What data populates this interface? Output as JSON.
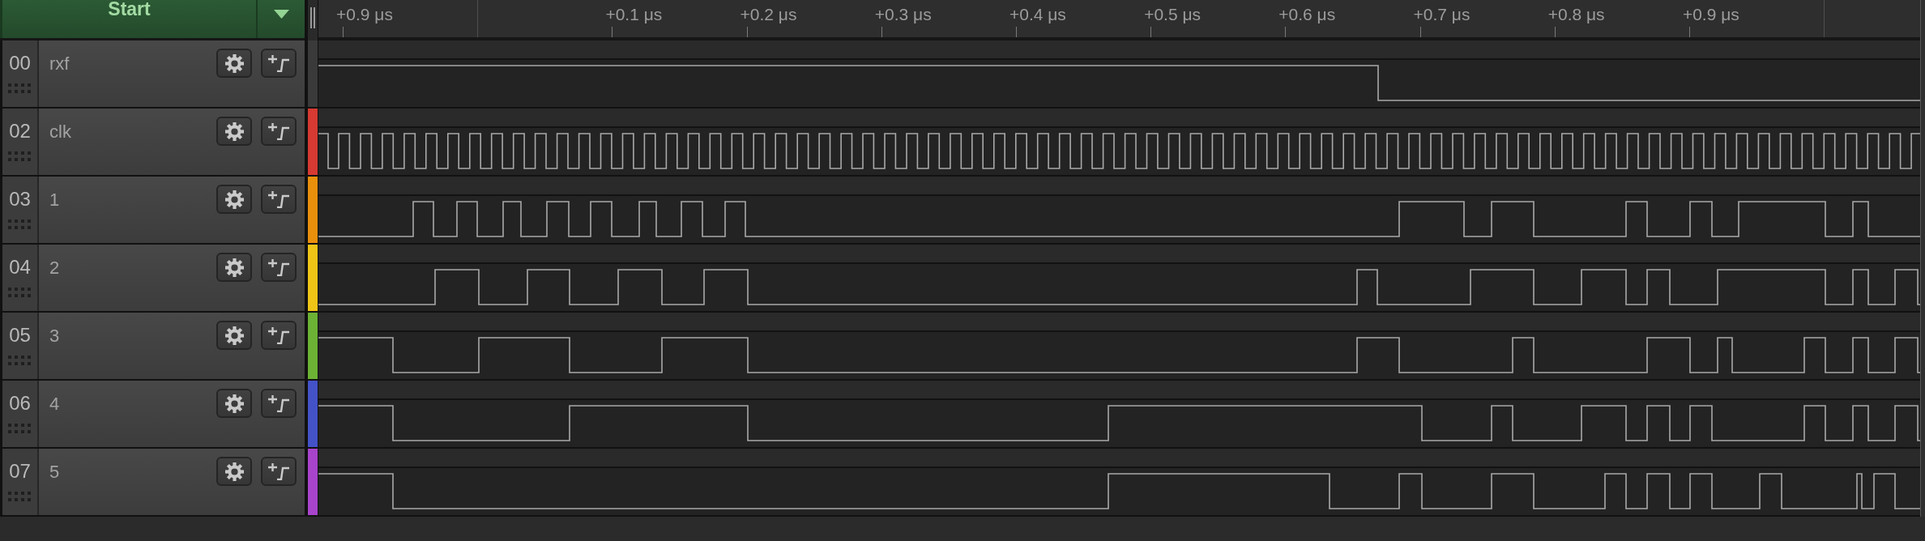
{
  "header": {
    "start_button": "Start"
  },
  "ruler": {
    "ticks": [
      {
        "kind": "labeled",
        "label": "+0.9 μs"
      },
      {
        "kind": "major"
      },
      {
        "kind": "labeled",
        "label": "+0.1 μs"
      },
      {
        "kind": "labeled",
        "label": "+0.2 μs"
      },
      {
        "kind": "labeled",
        "label": "+0.3 μs"
      },
      {
        "kind": "labeled",
        "label": "+0.4 μs"
      },
      {
        "kind": "labeled",
        "label": "+0.5 μs"
      },
      {
        "kind": "labeled",
        "label": "+0.6 μs"
      },
      {
        "kind": "labeled",
        "label": "+0.7 μs"
      },
      {
        "kind": "labeled",
        "label": "+0.8 μs"
      },
      {
        "kind": "labeled",
        "label": "+0.9 μs"
      },
      {
        "kind": "major"
      }
    ]
  },
  "channels": [
    {
      "number": "00",
      "name": "rxf",
      "color": "#3a3a3a"
    },
    {
      "number": "02",
      "name": "clk",
      "color": "#d63a32"
    },
    {
      "number": "03",
      "name": "1",
      "color": "#e8900c"
    },
    {
      "number": "04",
      "name": "2",
      "color": "#eec417"
    },
    {
      "number": "05",
      "name": "3",
      "color": "#6cb234"
    },
    {
      "number": "06",
      "name": "4",
      "color": "#4452c8"
    },
    {
      "number": "07",
      "name": "5",
      "color": "#a844cc"
    }
  ]
}
